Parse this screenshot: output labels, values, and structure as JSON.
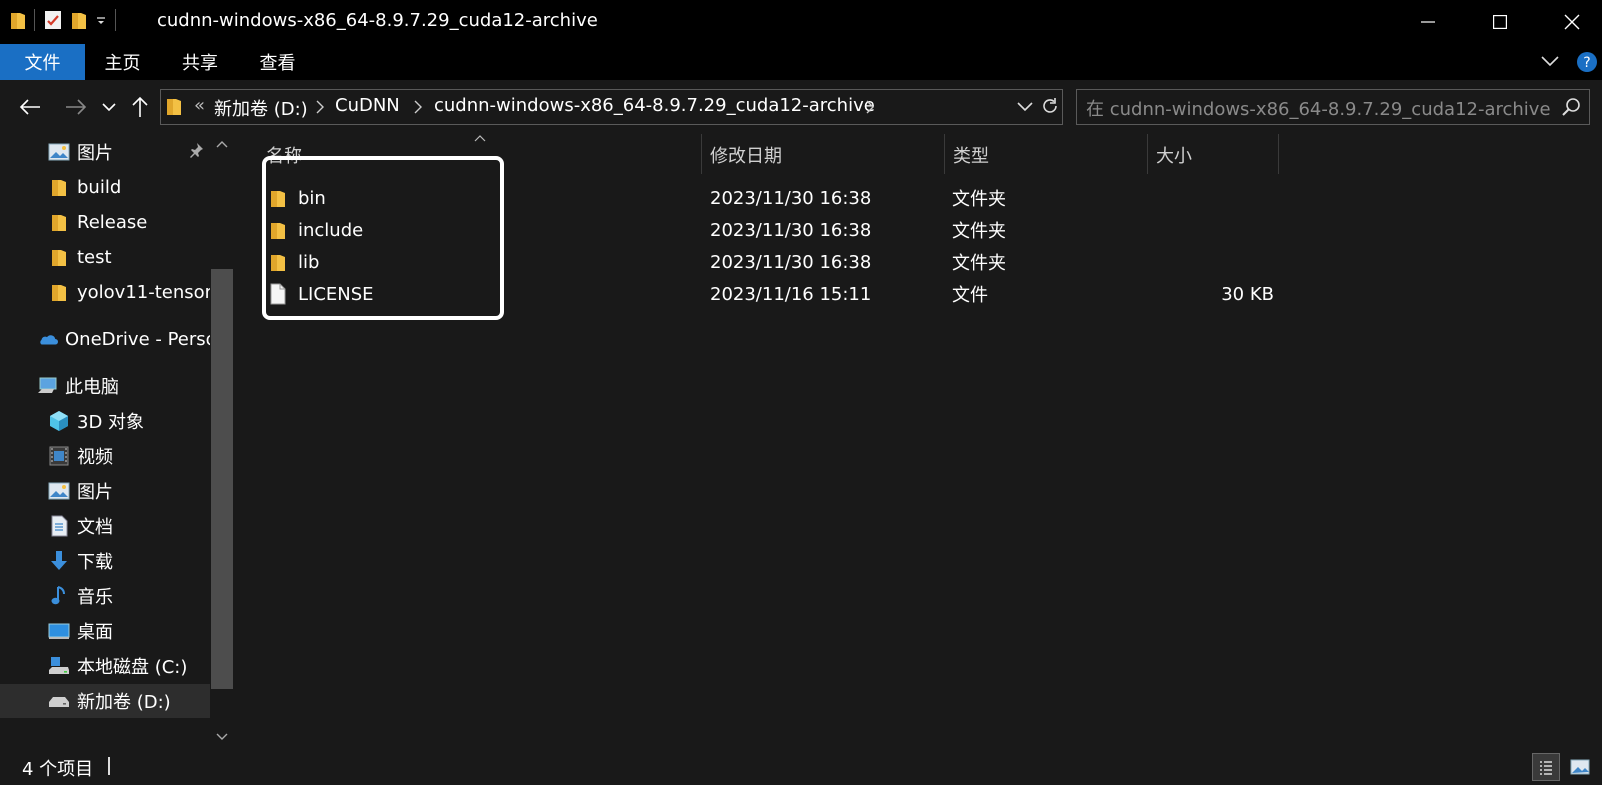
{
  "window": {
    "title": "cudnn-windows-x86_64-8.9.7.29_cuda12-archive"
  },
  "ribbon": {
    "tabs": [
      "文件",
      "主页",
      "共享",
      "查看"
    ]
  },
  "address": {
    "overflow": "«",
    "crumbs": [
      "新加卷 (D:)",
      "CuDNN",
      "cudnn-windows-x86_64-8.9.7.29_cuda12-archive"
    ]
  },
  "search": {
    "placeholder": "在 cudnn-windows-x86_64-8.9.7.29_cuda12-archive ..."
  },
  "nav": {
    "items": [
      {
        "label": "图片",
        "icon": "pictures-icon"
      },
      {
        "label": "build",
        "icon": "folder-icon"
      },
      {
        "label": "Release",
        "icon": "folder-icon"
      },
      {
        "label": "test",
        "icon": "folder-icon"
      },
      {
        "label": "yolov11-tensor",
        "icon": "folder-icon"
      },
      {
        "label": "OneDrive - Perso",
        "icon": "onedrive-icon"
      },
      {
        "label": "此电脑",
        "icon": "this-pc-icon"
      },
      {
        "label": "3D 对象",
        "icon": "3d-objects-icon"
      },
      {
        "label": "视频",
        "icon": "videos-icon"
      },
      {
        "label": "图片",
        "icon": "pictures-icon"
      },
      {
        "label": "文档",
        "icon": "documents-icon"
      },
      {
        "label": "下载",
        "icon": "downloads-icon"
      },
      {
        "label": "音乐",
        "icon": "music-icon"
      },
      {
        "label": "桌面",
        "icon": "desktop-icon"
      },
      {
        "label": "本地磁盘 (C:)",
        "icon": "drive-c-icon"
      },
      {
        "label": "新加卷 (D:)",
        "icon": "drive-d-icon"
      }
    ]
  },
  "columns": {
    "name": "名称",
    "date": "修改日期",
    "type": "类型",
    "size": "大小"
  },
  "files": [
    {
      "name": "bin",
      "date": "2023/11/30 16:38",
      "type": "文件夹",
      "size": "",
      "icon": "folder-icon"
    },
    {
      "name": "include",
      "date": "2023/11/30 16:38",
      "type": "文件夹",
      "size": "",
      "icon": "folder-icon"
    },
    {
      "name": "lib",
      "date": "2023/11/30 16:38",
      "type": "文件夹",
      "size": "",
      "icon": "folder-icon"
    },
    {
      "name": "LICENSE",
      "date": "2023/11/16 15:11",
      "type": "文件",
      "size": "30 KB",
      "icon": "file-icon"
    }
  ],
  "status": {
    "count": "4 个项目"
  },
  "colors": {
    "background": "#191919",
    "titlebar": "#000000",
    "accent": "#1a6fc4",
    "folder": "#f3c044"
  }
}
